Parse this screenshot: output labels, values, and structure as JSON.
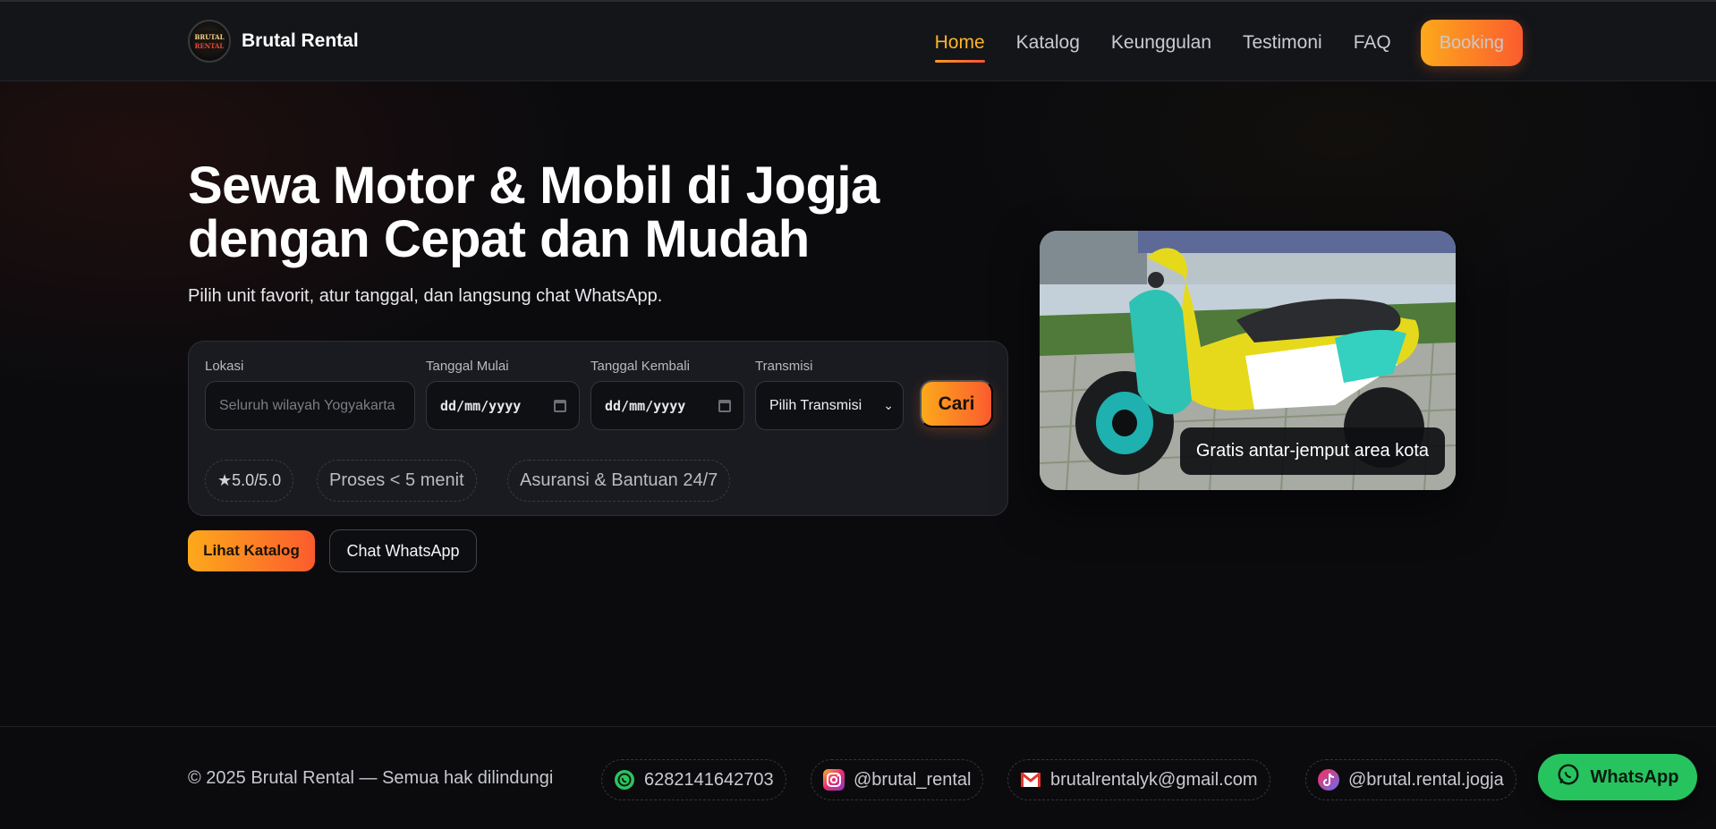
{
  "header": {
    "brand": "Brutal Rental",
    "logo_text": "BRUTAL RENTAL",
    "nav": [
      {
        "label": "Home",
        "active": true
      },
      {
        "label": "Katalog",
        "active": false
      },
      {
        "label": "Keunggulan",
        "active": false
      },
      {
        "label": "Testimoni",
        "active": false
      },
      {
        "label": "FAQ",
        "active": false
      }
    ],
    "booking_label": "Booking"
  },
  "hero": {
    "title_line1": "Sewa Motor & Mobil di Jogja",
    "title_line2": "dengan Cepat dan Mudah",
    "subtitle": "Pilih unit favorit, atur tanggal, dan langsung chat WhatsApp.",
    "image_caption": "Gratis antar-jemput area kota",
    "image_icon": "scooter-photo"
  },
  "search": {
    "location": {
      "label": "Lokasi",
      "placeholder": "Seluruh wilayah Yogyakarta"
    },
    "start_date": {
      "label": "Tanggal Mulai",
      "value": "dd/mm/yyyy"
    },
    "end_date": {
      "label": "Tanggal Kembali",
      "value": "dd/mm/yyyy"
    },
    "transmission": {
      "label": "Transmisi",
      "selected": "Pilih Transmisi"
    },
    "button": "Cari",
    "chips": [
      "★5.0/5.0",
      "Proses < 5 menit",
      "Asuransi & Bantuan 24/7"
    ]
  },
  "cta": {
    "primary": "Lihat Katalog",
    "secondary": "Chat WhatsApp"
  },
  "footer": {
    "copyright": "© 2025 Brutal Rental — Semua hak dilindungi",
    "contacts": [
      {
        "icon": "whatsapp-icon",
        "text": "6282141642703"
      },
      {
        "icon": "instagram-icon",
        "text": "@brutal_rental"
      },
      {
        "icon": "gmail-icon",
        "text": "brutalrentalyk@gmail.com"
      },
      {
        "icon": "tiktok-icon",
        "text": "@brutal.rental.jogja"
      }
    ],
    "whatsapp_float": "WhatsApp"
  },
  "colors": {
    "accent_start": "#fda91b",
    "accent_end": "#fb5b2e",
    "active_nav": "#fdb428",
    "whatsapp_green": "#27c35f",
    "background": "#0b0b0e"
  }
}
